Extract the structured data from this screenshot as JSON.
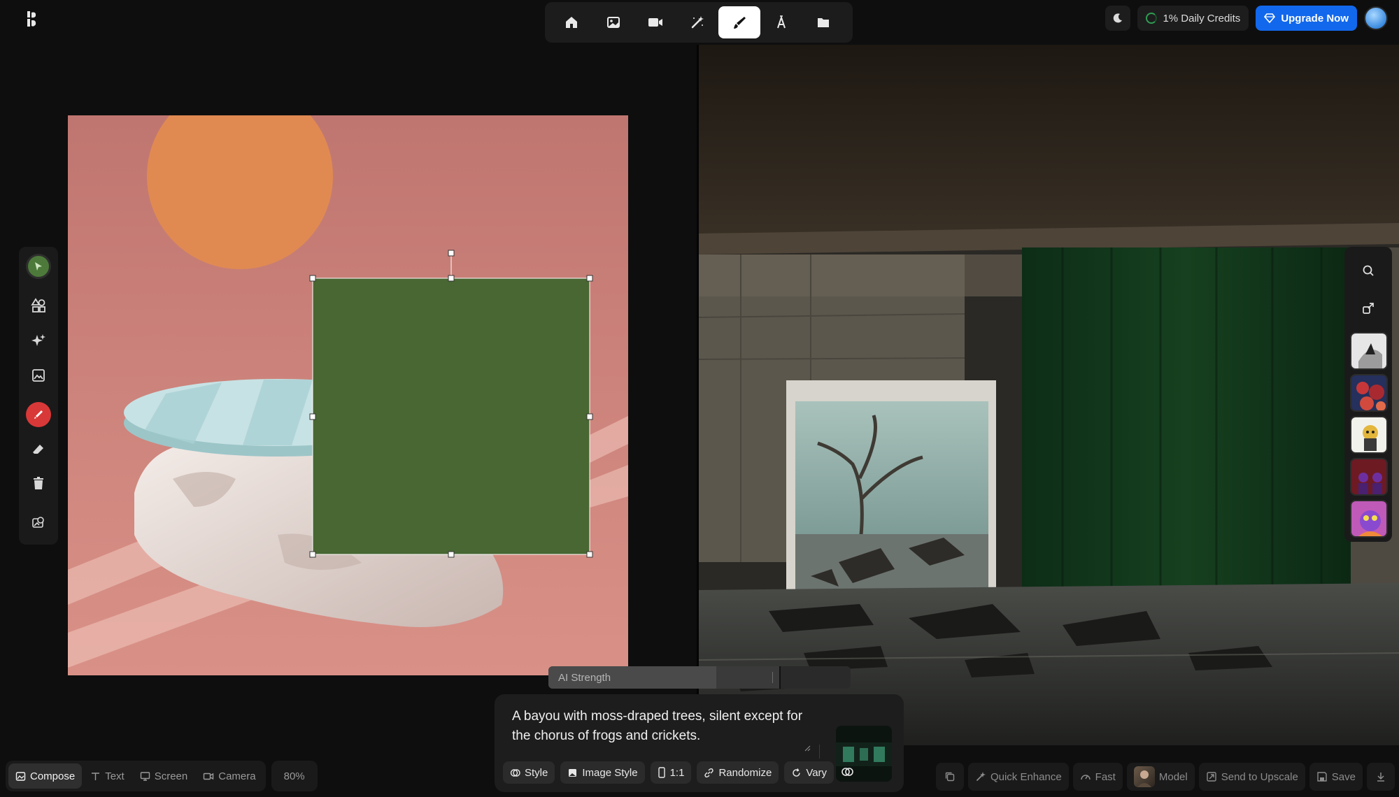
{
  "app": {
    "nav": [
      "home",
      "image",
      "video",
      "magic",
      "canvas",
      "text",
      "folder"
    ],
    "active_nav": "canvas"
  },
  "header": {
    "credits": "1% Daily Credits",
    "upgrade_label": "Upgrade Now"
  },
  "ai_strength": {
    "label": "AI Strength",
    "value": 0.75
  },
  "prompt": {
    "text": "A bayou with moss-draped trees, silent except for the chorus of frogs and crickets.",
    "chips": {
      "style": "Style",
      "image_style": "Image Style",
      "ratio": "1:1",
      "randomize": "Randomize",
      "vary": "Vary"
    }
  },
  "bottom_left": {
    "modes": {
      "compose": "Compose",
      "text": "Text",
      "screen": "Screen",
      "camera": "Camera"
    },
    "active_mode": "Compose",
    "zoom": "80%"
  },
  "bottom_right": {
    "quick_enhance": "Quick Enhance",
    "fast": "Fast",
    "model": "Model",
    "upscale": "Send to Upscale",
    "save": "Save"
  },
  "colors": {
    "accent_blue": "#1268ec",
    "select_green": "#4d7a3a",
    "shape_green": "#486733",
    "canvas_pink": "#c9817a",
    "sun_orange": "#e08a52"
  }
}
